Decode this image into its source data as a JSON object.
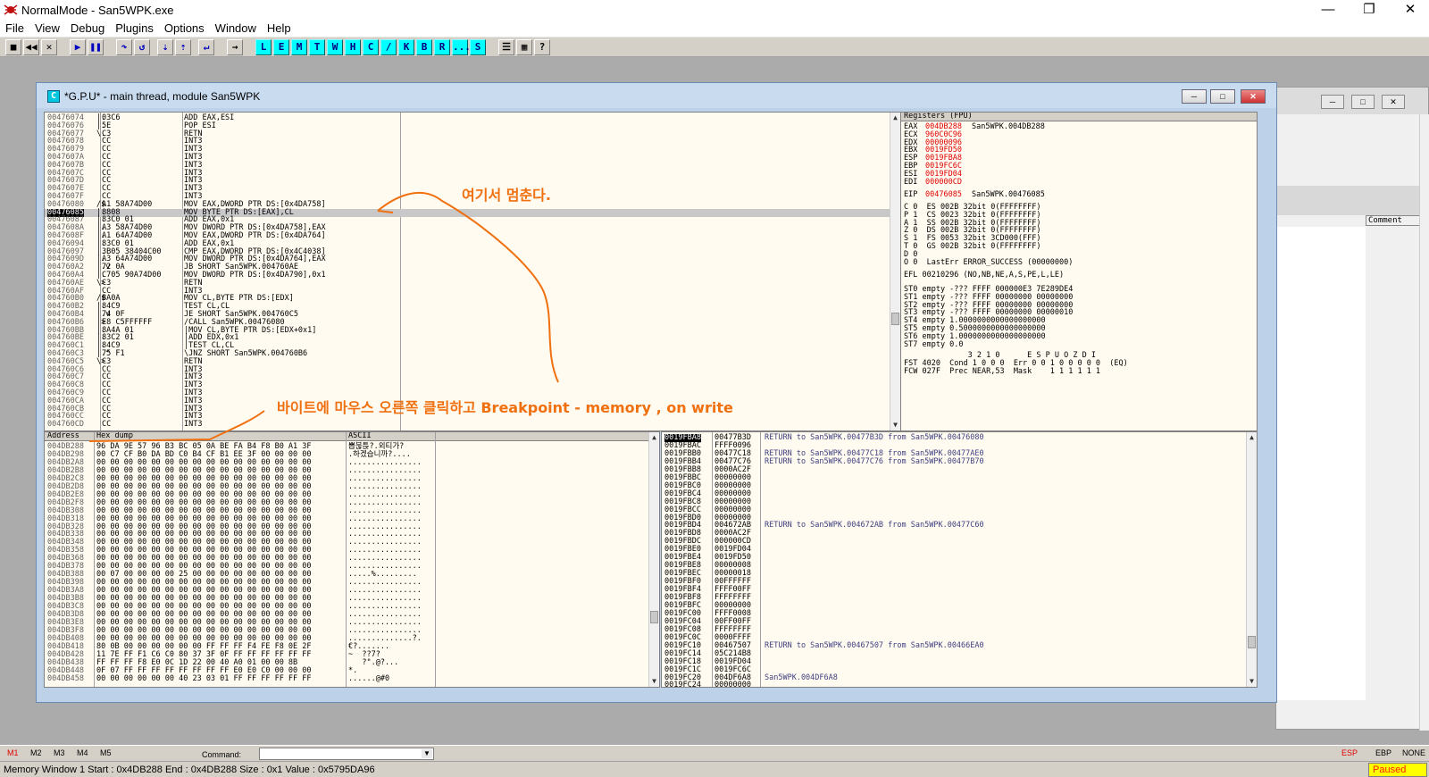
{
  "app": {
    "title": "NormalMode - San5WPK.exe"
  },
  "menu": [
    "File",
    "View",
    "Debug",
    "Plugins",
    "Options",
    "Window",
    "Help"
  ],
  "toolbar_letters": [
    "L",
    "E",
    "M",
    "T",
    "W",
    "H",
    "C",
    "/",
    "K",
    "B",
    "R",
    "...",
    "S"
  ],
  "cpu_window": {
    "title": "*G.P.U* - main thread, module San5WPK"
  },
  "back_window": {
    "comment_header": "Comment"
  },
  "disasm_rows": [
    {
      "addr": "00476074",
      "mark": "|.",
      "bytes": "03C6",
      "cmd": "ADD EAX,ESI"
    },
    {
      "addr": "00476076",
      "mark": "|.",
      "bytes": "5E",
      "cmd": "POP ESI"
    },
    {
      "addr": "00476077",
      "mark": "\\.",
      "bytes": "C3",
      "cmd": "RETN"
    },
    {
      "addr": "00476078",
      "mark": "",
      "bytes": "CC",
      "cmd": "INT3"
    },
    {
      "addr": "00476079",
      "mark": "",
      "bytes": "CC",
      "cmd": "INT3"
    },
    {
      "addr": "0047607A",
      "mark": "",
      "bytes": "CC",
      "cmd": "INT3"
    },
    {
      "addr": "0047607B",
      "mark": "",
      "bytes": "CC",
      "cmd": "INT3"
    },
    {
      "addr": "0047607C",
      "mark": "",
      "bytes": "CC",
      "cmd": "INT3"
    },
    {
      "addr": "0047607D",
      "mark": "",
      "bytes": "CC",
      "cmd": "INT3"
    },
    {
      "addr": "0047607E",
      "mark": "",
      "bytes": "CC",
      "cmd": "INT3"
    },
    {
      "addr": "0047607F",
      "mark": "",
      "bytes": "CC",
      "cmd": "INT3"
    },
    {
      "addr": "00476080",
      "mark": "/$",
      "bytes": "A1 58A74D00",
      "cmd": "MOV EAX,DWORD PTR DS:[0x4DA758]"
    },
    {
      "addr": "00476085",
      "mark": "|.",
      "bytes": "8808",
      "cmd": "MOV BYTE PTR DS:[EAX],CL"
    },
    {
      "addr": "00476087",
      "mark": "|.",
      "bytes": "83C0 01",
      "cmd": "ADD EAX,0x1"
    },
    {
      "addr": "0047608A",
      "mark": "|.",
      "bytes": "A3 58A74D00",
      "cmd": "MOV DWORD PTR DS:[0x4DA758],EAX"
    },
    {
      "addr": "0047608F",
      "mark": "|.",
      "bytes": "A1 64A74D00",
      "cmd": "MOV EAX,DWORD PTR DS:[0x4DA764]"
    },
    {
      "addr": "00476094",
      "mark": "|.",
      "bytes": "83C0 01",
      "cmd": "ADD EAX,0x1"
    },
    {
      "addr": "00476097",
      "mark": "|.",
      "bytes": "3B05 38404C00",
      "cmd": "CMP EAX,DWORD PTR DS:[0x4C4038]"
    },
    {
      "addr": "0047609D",
      "mark": "|.",
      "bytes": "A3 64A74D00",
      "cmd": "MOV DWORD PTR DS:[0x4DA764],EAX"
    },
    {
      "addr": "004760A2",
      "mark": "|.v",
      "bytes": "72 0A",
      "cmd": "JB SHORT San5WPK.004760AE"
    },
    {
      "addr": "004760A4",
      "mark": "|.",
      "bytes": "C705 90A74D00",
      "cmd": "MOV DWORD PTR DS:[0x4DA790],0x1"
    },
    {
      "addr": "004760AE",
      "mark": "\\>",
      "bytes": "C3",
      "cmd": "RETN"
    },
    {
      "addr": "004760AF",
      "mark": "",
      "bytes": "CC",
      "cmd": "INT3"
    },
    {
      "addr": "004760B0",
      "mark": "/$",
      "bytes": "8A0A",
      "cmd": "MOV CL,BYTE PTR DS:[EDX]"
    },
    {
      "addr": "004760B2",
      "mark": "|.",
      "bytes": "84C9",
      "cmd": "TEST CL,CL"
    },
    {
      "addr": "004760B4",
      "mark": "|.v",
      "bytes": "74 0F",
      "cmd": "JE SHORT San5WPK.004760C5"
    },
    {
      "addr": "004760B6",
      "mark": "|>",
      "bytes": "E8 C5FFFFFF",
      "cmd": "/CALL San5WPK.00476080"
    },
    {
      "addr": "004760BB",
      "mark": "|.",
      "bytes": "8A4A 01",
      "cmd": "|MOV CL,BYTE PTR DS:[EDX+0x1]"
    },
    {
      "addr": "004760BE",
      "mark": "|.",
      "bytes": "83C2 01",
      "cmd": "|ADD EDX,0x1"
    },
    {
      "addr": "004760C1",
      "mark": "|.",
      "bytes": "84C9",
      "cmd": "|TEST CL,CL"
    },
    {
      "addr": "004760C3",
      "mark": "|.^",
      "bytes": "75 F1",
      "cmd": "\\JNZ SHORT San5WPK.004760B6"
    },
    {
      "addr": "004760C5",
      "mark": "\\>",
      "bytes": "C3",
      "cmd": "RETN"
    },
    {
      "addr": "004760C6",
      "mark": "",
      "bytes": "CC",
      "cmd": "INT3"
    },
    {
      "addr": "004760C7",
      "mark": "",
      "bytes": "CC",
      "cmd": "INT3"
    },
    {
      "addr": "004760C8",
      "mark": "",
      "bytes": "CC",
      "cmd": "INT3"
    },
    {
      "addr": "004760C9",
      "mark": "",
      "bytes": "CC",
      "cmd": "INT3"
    },
    {
      "addr": "004760CA",
      "mark": "",
      "bytes": "CC",
      "cmd": "INT3"
    },
    {
      "addr": "004760CB",
      "mark": "",
      "bytes": "CC",
      "cmd": "INT3"
    },
    {
      "addr": "004760CC",
      "mark": "",
      "bytes": "CC",
      "cmd": "INT3"
    },
    {
      "addr": "004760CD",
      "mark": "",
      "bytes": "CC",
      "cmd": "INT3"
    }
  ],
  "selected_disasm_index": 12,
  "registers_header": "Registers (FPU)",
  "registers": [
    {
      "name": "EAX",
      "value": "004DB288",
      "note": "San5WPK.004DB288"
    },
    {
      "name": "ECX",
      "value": "960C0C96",
      "note": ""
    },
    {
      "name": "EDX",
      "value": "00000096",
      "note": ""
    },
    {
      "name": "EBX",
      "value": "0019FD50",
      "note": ""
    },
    {
      "name": "ESP",
      "value": "0019FBA8",
      "note": ""
    },
    {
      "name": "EBP",
      "value": "0019FC6C",
      "note": ""
    },
    {
      "name": "ESI",
      "value": "0019FD04",
      "note": ""
    },
    {
      "name": "EDI",
      "value": "000000CD",
      "note": ""
    }
  ],
  "eip": {
    "name": "EIP",
    "value": "00476085",
    "note": "San5WPK.00476085"
  },
  "flags": [
    "C 0  ES 002B 32bit 0(FFFFFFFF)",
    "P 1  CS 0023 32bit 0(FFFFFFFF)",
    "A 1  SS 002B 32bit 0(FFFFFFFF)",
    "Z 0  DS 002B 32bit 0(FFFFFFFF)",
    "S 1  FS 0053 32bit 3CD000(FFF)",
    "T 0  GS 002B 32bit 0(FFFFFFFF)",
    "D 0",
    "O 0  LastErr ERROR_SUCCESS (00000000)"
  ],
  "efl": "EFL 00210296 (NO,NB,NE,A,S,PE,L,LE)",
  "fpu": [
    "ST0 empty -??? FFFF 000000E3 7E289DE4",
    "ST1 empty -??? FFFF 00000000 00000000",
    "ST2 empty -??? FFFF 00000000 00000000",
    "ST3 empty -??? FFFF 00000000 00000010",
    "ST4 empty 1.0000000000000000000",
    "ST5 empty 0.5000000000000000000",
    "ST6 empty 1.0000000000000000000",
    "ST7 empty 0.0"
  ],
  "fpu_status": [
    "              3 2 1 0      E S P U O Z D I",
    "FST 4020  Cond 1 0 0 0  Err 0 0 1 0 0 0 0 0  (EQ)",
    "FCW 027F  Prec NEAR,53  Mask    1 1 1 1 1 1"
  ],
  "dump_header": {
    "address": "Address",
    "hex": "Hex dump",
    "ascii": "ASCII"
  },
  "dump_rows": [
    {
      "addr": "004DB288",
      "hex": "96 DA 9E 57 96 B3 BC 05 0A BE FA B4 F8 B0 A1 3F",
      "ascii": "뽑붆튽?.외티가?"
    },
    {
      "addr": "004DB298",
      "hex": "00 C7 CF B0 DA BD C0 B4 CF B1 EE 3F 00 00 00 00",
      "ascii": ".하겠습니까?...."
    },
    {
      "addr": "004DB2A8",
      "hex": "00 00 00 00 00 00 00 00 00 00 00 00 00 00 00 00",
      "ascii": "................"
    },
    {
      "addr": "004DB2B8",
      "hex": "00 00 00 00 00 00 00 00 00 00 00 00 00 00 00 00",
      "ascii": "................"
    },
    {
      "addr": "004DB2C8",
      "hex": "00 00 00 00 00 00 00 00 00 00 00 00 00 00 00 00",
      "ascii": "................"
    },
    {
      "addr": "004DB2D8",
      "hex": "00 00 00 00 00 00 00 00 00 00 00 00 00 00 00 00",
      "ascii": "................"
    },
    {
      "addr": "004DB2E8",
      "hex": "00 00 00 00 00 00 00 00 00 00 00 00 00 00 00 00",
      "ascii": "................"
    },
    {
      "addr": "004DB2F8",
      "hex": "00 00 00 00 00 00 00 00 00 00 00 00 00 00 00 00",
      "ascii": "................"
    },
    {
      "addr": "004DB308",
      "hex": "00 00 00 00 00 00 00 00 00 00 00 00 00 00 00 00",
      "ascii": "................"
    },
    {
      "addr": "004DB318",
      "hex": "00 00 00 00 00 00 00 00 00 00 00 00 00 00 00 00",
      "ascii": "................"
    },
    {
      "addr": "004DB328",
      "hex": "00 00 00 00 00 00 00 00 00 00 00 00 00 00 00 00",
      "ascii": "................"
    },
    {
      "addr": "004DB338",
      "hex": "00 00 00 00 00 00 00 00 00 00 00 00 00 00 00 00",
      "ascii": "................"
    },
    {
      "addr": "004DB348",
      "hex": "00 00 00 00 00 00 00 00 00 00 00 00 00 00 00 00",
      "ascii": "................"
    },
    {
      "addr": "004DB358",
      "hex": "00 00 00 00 00 00 00 00 00 00 00 00 00 00 00 00",
      "ascii": "................"
    },
    {
      "addr": "004DB368",
      "hex": "00 00 00 00 00 00 00 00 00 00 00 00 00 00 00 00",
      "ascii": "................"
    },
    {
      "addr": "004DB378",
      "hex": "00 00 00 00 00 00 00 00 00 00 00 00 00 00 00 00",
      "ascii": "................"
    },
    {
      "addr": "004DB388",
      "hex": "00 07 00 00 00 00 25 00 00 00 00 00 00 00 00 00",
      "ascii": ".....%........."
    },
    {
      "addr": "004DB398",
      "hex": "00 00 00 00 00 00 00 00 00 00 00 00 00 00 00 00",
      "ascii": "................"
    },
    {
      "addr": "004DB3A8",
      "hex": "00 00 00 00 00 00 00 00 00 00 00 00 00 00 00 00",
      "ascii": "................"
    },
    {
      "addr": "004DB3B8",
      "hex": "00 00 00 00 00 00 00 00 00 00 00 00 00 00 00 00",
      "ascii": "................"
    },
    {
      "addr": "004DB3C8",
      "hex": "00 00 00 00 00 00 00 00 00 00 00 00 00 00 00 00",
      "ascii": "................"
    },
    {
      "addr": "004DB3D8",
      "hex": "00 00 00 00 00 00 00 00 00 00 00 00 00 00 00 00",
      "ascii": "................"
    },
    {
      "addr": "004DB3E8",
      "hex": "00 00 00 00 00 00 00 00 00 00 00 00 00 00 00 00",
      "ascii": "................"
    },
    {
      "addr": "004DB3F8",
      "hex": "00 00 00 00 00 00 00 00 00 00 00 00 00 00 00 00",
      "ascii": "................"
    },
    {
      "addr": "004DB408",
      "hex": "00 00 00 00 00 00 00 00 00 00 00 00 00 00 00 00",
      "ascii": "..............?."
    },
    {
      "addr": "004DB418",
      "hex": "80 0B 00 00 00 00 00 00 FF FF FF F4 FE F8 0E 2F",
      "ascii": "€?.......       "
    },
    {
      "addr": "004DB428",
      "hex": "11 7E FF F1 C6 C0 80 37 3F 0F FF FF FF FF FF FF",
      "ascii": "~  ??7?    "
    },
    {
      "addr": "004DB438",
      "hex": "FF FF FF F8 E0 0C 1D 22 00 40 A0 01 00 00 8B",
      "ascii": "   ?\".@?..."
    },
    {
      "addr": "004DB448",
      "hex": "0F 07 FF FF FF FF FF FF FF FF E0 E0 C0 00 00 00",
      "ascii": "*."
    },
    {
      "addr": "004DB458",
      "hex": "00 00 00 00 00 00 40 23 03 01 FF FF FF FF FF FF",
      "ascii": "......@#0"
    }
  ],
  "stack_rows": [
    {
      "addr": "0019FBA8",
      "value": "00477B3D",
      "comment": "RETURN to San5WPK.00477B3D from San5WPK.00476080"
    },
    {
      "addr": "0019FBAC",
      "value": "FFFF0096",
      "comment": ""
    },
    {
      "addr": "0019FBB0",
      "value": "00477C18",
      "comment": "RETURN to San5WPK.00477C18 from San5WPK.00477AE0"
    },
    {
      "addr": "0019FBB4",
      "value": "00477C76",
      "comment": "RETURN to San5WPK.00477C76 from San5WPK.00477B70"
    },
    {
      "addr": "0019FBB8",
      "value": "0000AC2F",
      "comment": ""
    },
    {
      "addr": "0019FBBC",
      "value": "00000000",
      "comment": ""
    },
    {
      "addr": "0019FBC0",
      "value": "00000000",
      "comment": ""
    },
    {
      "addr": "0019FBC4",
      "value": "00000000",
      "comment": ""
    },
    {
      "addr": "0019FBC8",
      "value": "00000000",
      "comment": ""
    },
    {
      "addr": "0019FBCC",
      "value": "00000000",
      "comment": ""
    },
    {
      "addr": "0019FBD0",
      "value": "00000000",
      "comment": ""
    },
    {
      "addr": "0019FBD4",
      "value": "004672AB",
      "comment": "RETURN to San5WPK.004672AB from San5WPK.00477C60"
    },
    {
      "addr": "0019FBD8",
      "value": "0000AC2F",
      "comment": ""
    },
    {
      "addr": "0019FBDC",
      "value": "000000CD",
      "comment": ""
    },
    {
      "addr": "0019FBE0",
      "value": "0019FD04",
      "comment": ""
    },
    {
      "addr": "0019FBE4",
      "value": "0019FD50",
      "comment": ""
    },
    {
      "addr": "0019FBE8",
      "value": "00000008",
      "comment": ""
    },
    {
      "addr": "0019FBEC",
      "value": "00000018",
      "comment": ""
    },
    {
      "addr": "0019FBF0",
      "value": "00FFFFFF",
      "comment": ""
    },
    {
      "addr": "0019FBF4",
      "value": "FFFF00FF",
      "comment": ""
    },
    {
      "addr": "0019FBF8",
      "value": "FFFFFFFF",
      "comment": ""
    },
    {
      "addr": "0019FBFC",
      "value": "00000000",
      "comment": ""
    },
    {
      "addr": "0019FC00",
      "value": "FFFF0008",
      "comment": ""
    },
    {
      "addr": "0019FC04",
      "value": "00FF00FF",
      "comment": ""
    },
    {
      "addr": "0019FC08",
      "value": "FFFFFFFF",
      "comment": ""
    },
    {
      "addr": "0019FC0C",
      "value": "0000FFFF",
      "comment": ""
    },
    {
      "addr": "0019FC10",
      "value": "00467507",
      "comment": "RETURN to San5WPK.00467507 from San5WPK.00466EA0"
    },
    {
      "addr": "0019FC14",
      "value": "05C214B8",
      "comment": ""
    },
    {
      "addr": "0019FC18",
      "value": "0019FD04",
      "comment": ""
    },
    {
      "addr": "0019FC1C",
      "value": "0019FC6C",
      "comment": ""
    },
    {
      "addr": "0019FC20",
      "value": "004DF6A8",
      "comment": "San5WPK.004DF6A8"
    },
    {
      "addr": "0019FC24",
      "value": "00000000",
      "comment": ""
    }
  ],
  "annotations": {
    "stop_here": "여기서 멈춘다.",
    "breakpoint_hint": "바이트에 마우스 오른쪽 클릭하고 Breakpoint - memory , on write"
  },
  "cmdbar": {
    "marks": [
      "M1",
      "M2",
      "M3",
      "M4",
      "M5"
    ],
    "command_label": "Command:",
    "command_value": "",
    "regs": [
      "ESP",
      "EBP",
      "NONE"
    ]
  },
  "status": {
    "text": "Memory Window 1  Start : 0x4DB288  End : 0x4DB288  Size : 0x1  Value : 0x5795DA96",
    "state": "Paused"
  }
}
